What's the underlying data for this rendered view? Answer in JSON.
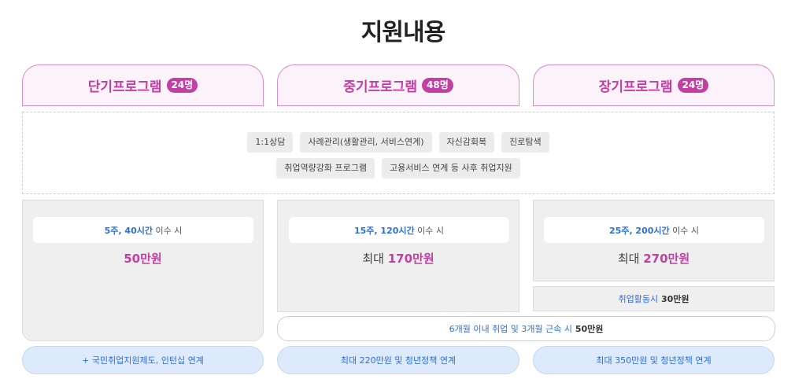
{
  "title": "지원내용",
  "programs": [
    {
      "name": "단기프로그램",
      "badge": "24명"
    },
    {
      "name": "중기프로그램",
      "badge": "48명"
    },
    {
      "name": "장기프로그램",
      "badge": "24명"
    }
  ],
  "common_services": {
    "row1": [
      "1:1상담",
      "사례관리(생활관리, 서비스연계)",
      "자신감회복",
      "진로탐색"
    ],
    "row2": [
      "취업역량강화 프로그램",
      "고용서비스 연계 등 사후 취업지원"
    ]
  },
  "completion": [
    {
      "condition_highlight": "5주, 40시간",
      "condition_suffix": " 이수 시",
      "amount_prefix": "",
      "amount": "50만원"
    },
    {
      "condition_highlight": "15주, 120시간",
      "condition_suffix": " 이수 시",
      "amount_prefix": "최대 ",
      "amount": "170만원"
    },
    {
      "condition_highlight": "25주, 200시간",
      "condition_suffix": " 이수 시",
      "amount_prefix": "최대 ",
      "amount": "270만원"
    }
  ],
  "job_activity_bonus": {
    "highlight": "취업활동시",
    "amount": " 30만원"
  },
  "employment_bonus": {
    "highlight": "6개월 이내 취업 및 3개월 근속 시",
    "amount": " 50만원"
  },
  "links": [
    "+ 국민취업지원제도, 인턴십 연계",
    "최대 220만원 및 청년정책 연계",
    "최대 350만원 및 청년정책 연계"
  ],
  "colors": {
    "pink": "#c23fa4",
    "blue": "#2f6fd6",
    "pill_bg": "#dceafc"
  }
}
